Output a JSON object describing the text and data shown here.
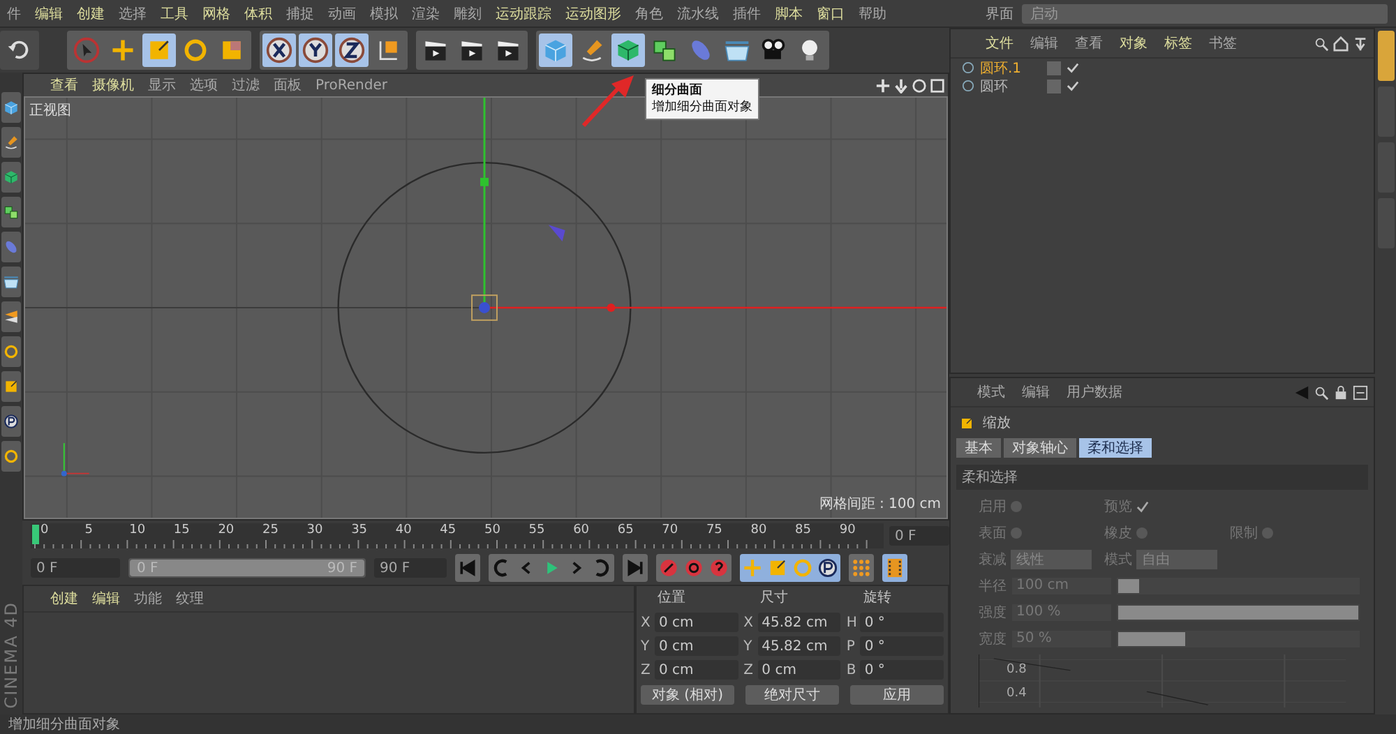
{
  "menu_bar": {
    "items": [
      {
        "label": "件",
        "bright": false
      },
      {
        "label": "编辑",
        "bright": true
      },
      {
        "label": "创建",
        "bright": true
      },
      {
        "label": "选择",
        "bright": false
      },
      {
        "label": "工具",
        "bright": true
      },
      {
        "label": "网格",
        "bright": true
      },
      {
        "label": "体积",
        "bright": true
      },
      {
        "label": "捕捉",
        "bright": false
      },
      {
        "label": "动画",
        "bright": false
      },
      {
        "label": "模拟",
        "bright": false
      },
      {
        "label": "渲染",
        "bright": false
      },
      {
        "label": "雕刻",
        "bright": false
      },
      {
        "label": "运动跟踪",
        "bright": true
      },
      {
        "label": "运动图形",
        "bright": true
      },
      {
        "label": "角色",
        "bright": false
      },
      {
        "label": "流水线",
        "bright": false
      },
      {
        "label": "插件",
        "bright": false
      },
      {
        "label": "脚本",
        "bright": true
      },
      {
        "label": "窗口",
        "bright": true
      },
      {
        "label": "帮助",
        "bright": false
      }
    ],
    "layout_label": "界面",
    "layout_value": "启动"
  },
  "toolbar": [
    {
      "selected": false
    },
    {
      "selected": false
    },
    {
      "selected": false
    },
    {
      "selected": true
    },
    {
      "selected": false
    },
    {
      "selected": false
    },
    {
      "selected": true
    },
    {
      "selected": true
    },
    {
      "selected": true
    },
    {
      "selected": false
    },
    {
      "selected": false
    },
    {
      "selected": false
    },
    {
      "selected": false
    },
    {
      "selected": true
    },
    {
      "selected": false
    },
    {
      "selected": true
    },
    {
      "selected": false
    },
    {
      "selected": false
    },
    {
      "selected": false
    },
    {
      "selected": false
    },
    {
      "selected": false
    }
  ],
  "tooltip": {
    "title": "细分曲面",
    "text": "增加细分曲面对象"
  },
  "viewport": {
    "menu": [
      {
        "label": "查看",
        "bright": true
      },
      {
        "label": "摄像机",
        "bright": true
      },
      {
        "label": "显示",
        "bright": false
      },
      {
        "label": "选项",
        "bright": false
      },
      {
        "label": "过滤",
        "bright": false
      },
      {
        "label": "面板",
        "bright": false
      },
      {
        "label": "ProRender",
        "bright": false
      }
    ],
    "view_name": "正视图",
    "grid_spacing": "网格间距 : 100 cm"
  },
  "timeline": {
    "ruler": [
      "0",
      "5",
      "10",
      "15",
      "20",
      "25",
      "30",
      "35",
      "40",
      "45",
      "50",
      "55",
      "60",
      "65",
      "70",
      "75",
      "80",
      "85",
      "90"
    ],
    "current_frame": "0 F"
  },
  "transport": {
    "start": "0 F",
    "range_start": "0 F",
    "range_end": "90 F",
    "end": "90 F",
    "level": 1
  },
  "side_tabs": [
    {
      "selected": true
    },
    {
      "selected": false
    },
    {
      "selected": false
    },
    {
      "selected": false
    }
  ],
  "material_manager": {
    "menu": [
      {
        "label": "创建",
        "bright": true
      },
      {
        "label": "编辑",
        "bright": true
      },
      {
        "label": "功能",
        "bright": false
      },
      {
        "label": "纹理",
        "bright": false
      }
    ]
  },
  "coordinates": {
    "headers": [
      "位置",
      "尺寸",
      "旋转"
    ],
    "rows": [
      [
        {
          "axis": "X",
          "value": "0 cm"
        },
        {
          "axis": "X",
          "value": "45.82 cm"
        },
        {
          "axis": "H",
          "value": "0 °"
        }
      ],
      [
        {
          "axis": "Y",
          "value": "0 cm"
        },
        {
          "axis": "Y",
          "value": "45.82 cm"
        },
        {
          "axis": "P",
          "value": "0 °"
        }
      ],
      [
        {
          "axis": "Z",
          "value": "0 cm"
        },
        {
          "axis": "Z",
          "value": "0 cm"
        },
        {
          "axis": "B",
          "value": "0 °"
        }
      ]
    ],
    "mode": "对象 (相对)",
    "size_mode": "绝对尺寸",
    "apply": "应用"
  },
  "object_manager": {
    "menu": [
      {
        "label": "文件",
        "bright": true
      },
      {
        "label": "编辑",
        "bright": false
      },
      {
        "label": "查看",
        "bright": false
      },
      {
        "label": "对象",
        "bright": true
      },
      {
        "label": "标签",
        "bright": true
      },
      {
        "label": "书签",
        "bright": false
      }
    ],
    "objects": [
      {
        "name": "圆环.1",
        "selected": true
      },
      {
        "name": "圆环",
        "selected": false
      }
    ]
  },
  "attribute_manager": {
    "menu": [
      "模式",
      "编辑",
      "用户数据"
    ],
    "title": "缩放",
    "tabs": [
      {
        "label": "基本",
        "selected": false
      },
      {
        "label": "对象轴心",
        "selected": false
      },
      {
        "label": "柔和选择",
        "selected": true
      }
    ],
    "section": "柔和选择",
    "rows": [
      [
        {
          "kind": "check",
          "label": "启用",
          "checked": false
        },
        {
          "kind": "check",
          "label": "预览",
          "checked": true
        }
      ],
      [
        {
          "kind": "check",
          "label": "表面",
          "checked": false
        },
        {
          "kind": "check",
          "label": "橡皮",
          "checked": false
        },
        {
          "kind": "check",
          "label": "限制",
          "checked": false
        }
      ],
      [
        {
          "kind": "select",
          "label": "衰减",
          "value": "线性"
        },
        {
          "kind": "select",
          "label": "模式",
          "value": "自由"
        }
      ],
      [
        {
          "kind": "slider",
          "label": "半径",
          "value": "100 cm",
          "level": 0.1
        }
      ],
      [
        {
          "kind": "slider",
          "label": "强度",
          "value": "100 %",
          "level": 1
        }
      ],
      [
        {
          "kind": "slider",
          "label": "宽度",
          "value": "50 %",
          "level": 0.29
        }
      ]
    ],
    "graph_ticks": [
      "0.8",
      "0.4"
    ]
  },
  "logo": "CINEMA 4D",
  "status_bar": "增加细分曲面对象"
}
